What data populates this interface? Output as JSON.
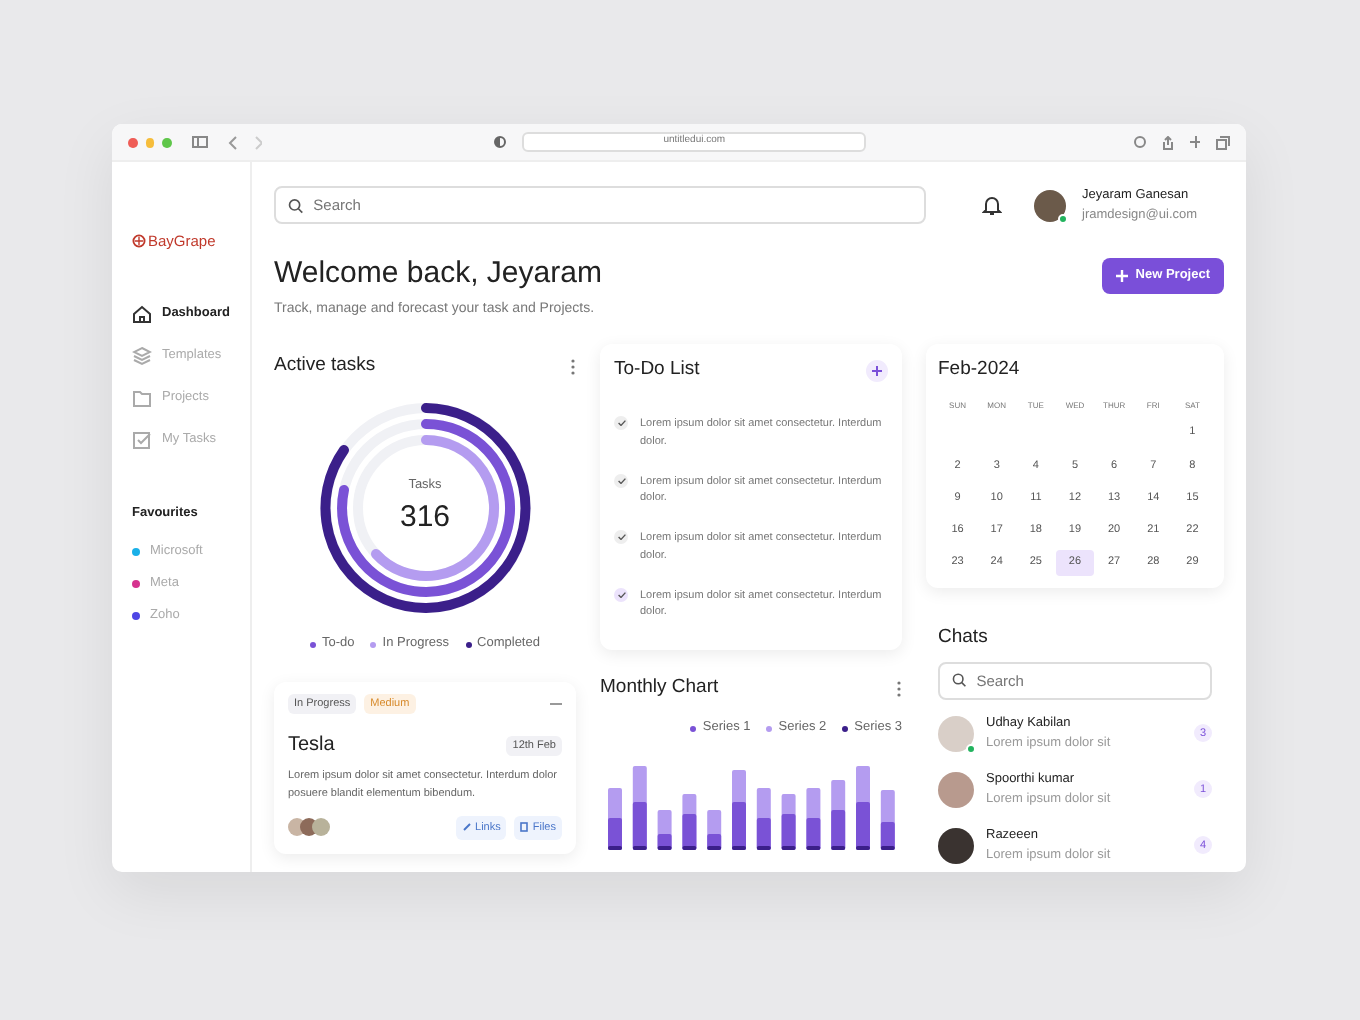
{
  "browser": {
    "url": "untitledui.com"
  },
  "sidebar": {
    "logo": "BayGrape",
    "items": [
      {
        "label": "Dashboard",
        "selected": true
      },
      {
        "label": "Templates",
        "selected": false
      },
      {
        "label": "Projects",
        "selected": false
      },
      {
        "label": "My Tasks",
        "selected": false
      }
    ],
    "favourites_title": "Favourites",
    "favourites": [
      {
        "label": "Microsoft",
        "color": "#1ab0e8"
      },
      {
        "label": "Meta",
        "color": "#d6338f"
      },
      {
        "label": "Zoho",
        "color": "#4f46e5"
      }
    ]
  },
  "header": {
    "search_placeholder": "Search",
    "user": {
      "name": "Jeyaram Ganesan",
      "email": "jramdesign@ui.com",
      "online": true
    }
  },
  "welcome": {
    "title": "Welcome back, Jeyaram",
    "subtitle": "Track, manage and forecast your task and Projects.",
    "button": "New Project"
  },
  "active_tasks": {
    "title": "Active tasks",
    "center_label": "Tasks",
    "center_value": "316",
    "legend": [
      {
        "label": "To-do",
        "color": "#7a52d6"
      },
      {
        "label": "In Progress",
        "color": "#b49cf0"
      },
      {
        "label": "Completed",
        "color": "#3b1f8a"
      }
    ]
  },
  "task_card": {
    "tags": [
      {
        "label": "In Progress",
        "kind": "status"
      },
      {
        "label": "Medium",
        "kind": "priority"
      }
    ],
    "title": "Tesla",
    "date": "12th Feb",
    "description": "Lorem ipsum dolor sit amet consectetur. Interdum dolor posuere blandit elementum bibendum.",
    "links": "Links",
    "files": "Files"
  },
  "todo": {
    "title": "To-Do List",
    "items": [
      {
        "text": "Lorem ipsum dolor sit amet consectetur. Interdum dolor.",
        "checked": true,
        "color": "#eeeeee"
      },
      {
        "text": "Lorem ipsum dolor sit amet consectetur. Interdum dolor.",
        "checked": true,
        "color": "#eeeeee"
      },
      {
        "text": "Lorem ipsum dolor sit amet consectetur. Interdum dolor.",
        "checked": true,
        "color": "#eeeeee"
      },
      {
        "text": "Lorem ipsum dolor sit amet consectetur. Interdum dolor.",
        "checked": true,
        "color": "#ece3fc"
      }
    ]
  },
  "monthly_chart": {
    "title": "Monthly Chart",
    "legend": [
      {
        "label": "Series 1",
        "color": "#7a52d6"
      },
      {
        "label": "Series 2",
        "color": "#b49cf0"
      },
      {
        "label": "Series 3",
        "color": "#3b1f8a"
      }
    ]
  },
  "calendar": {
    "title": "Feb-2024",
    "weekdays": [
      "SUN",
      "MON",
      "TUE",
      "WED",
      "THUR",
      "FRI",
      "SAT"
    ],
    "weeks": [
      [
        {
          "label": "1",
          "selected": false
        }
      ],
      [
        {
          "label": "2",
          "selected": false
        },
        {
          "label": "3",
          "selected": false
        },
        {
          "label": "4",
          "selected": false
        },
        {
          "label": "5",
          "selected": false
        },
        {
          "label": "6",
          "selected": false
        },
        {
          "label": "7",
          "selected": false
        },
        {
          "label": "8",
          "selected": false
        }
      ],
      [
        {
          "label": "9",
          "selected": false
        },
        {
          "label": "10",
          "selected": false
        },
        {
          "label": "11",
          "selected": false
        },
        {
          "label": "12",
          "selected": false
        },
        {
          "label": "13",
          "selected": false
        },
        {
          "label": "14",
          "selected": false
        },
        {
          "label": "15",
          "selected": false
        }
      ],
      [
        {
          "label": "16",
          "selected": false
        },
        {
          "label": "17",
          "selected": false
        },
        {
          "label": "18",
          "selected": false
        },
        {
          "label": "19",
          "selected": false
        },
        {
          "label": "20",
          "selected": false
        },
        {
          "label": "21",
          "selected": false
        },
        {
          "label": "22",
          "selected": false
        }
      ],
      [
        {
          "label": "23",
          "selected": false
        },
        {
          "label": "24",
          "selected": false
        },
        {
          "label": "25",
          "selected": false
        },
        {
          "label": "26",
          "selected": true
        },
        {
          "label": "27",
          "selected": false
        },
        {
          "label": "28",
          "selected": false
        },
        {
          "label": "29",
          "selected": false
        }
      ]
    ]
  },
  "chats": {
    "title": "Chats",
    "search_placeholder": "Search",
    "items": [
      {
        "name": "Udhay Kabilan",
        "message": "Lorem ipsum dolor sit",
        "unread": "3",
        "online": true
      },
      {
        "name": "Spoorthi kumar",
        "message": "Lorem ipsum dolor sit",
        "unread": "1",
        "online": false
      },
      {
        "name": "Razeeen",
        "message": "Lorem ipsum dolor sit",
        "unread": "4",
        "online": false
      }
    ]
  }
}
